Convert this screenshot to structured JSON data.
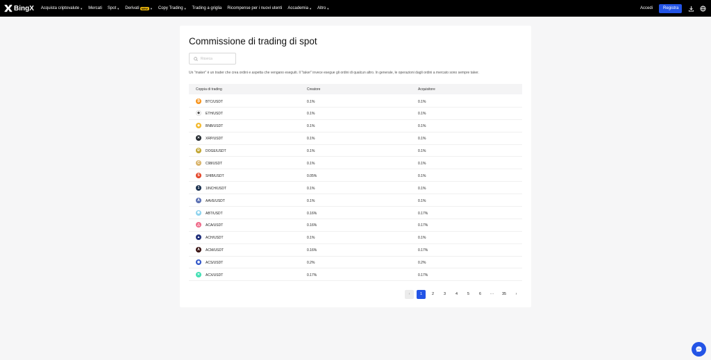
{
  "brand": {
    "name": "BingX"
  },
  "nav": {
    "items": [
      {
        "label": "Acquista criptovalute",
        "dropdown": true
      },
      {
        "label": "Mercati",
        "dropdown": false
      },
      {
        "label": "Spot",
        "dropdown": true
      },
      {
        "label": "Derivati",
        "dropdown": true,
        "badge": "NEW"
      },
      {
        "label": "Copy Trading",
        "dropdown": true
      },
      {
        "label": "Trading a griglia",
        "dropdown": false
      },
      {
        "label": "Ricompense per i nuovi utenti",
        "dropdown": false
      },
      {
        "label": "Accademia",
        "dropdown": true
      },
      {
        "label": "Altro",
        "dropdown": true
      }
    ],
    "login_label": "Accedi",
    "register_label": "Registra",
    "icons": [
      "download-icon",
      "globe-icon"
    ]
  },
  "page": {
    "title": "Commissione di trading di spot",
    "search_placeholder": "Ricerca",
    "description": "Un \"maker\" è un trader che crea ordini e aspetta che vengano eseguiti. Il \"taker\" invece esegue gli ordini di qualcun altro. In generale, le operazioni dagli ordini a mercato sono sempre taker."
  },
  "table": {
    "headers": {
      "pair": "Coppia di trading",
      "maker": "Creatore",
      "taker": "Acquisitore"
    },
    "rows": [
      {
        "pair": "BTC/USDT",
        "maker": "0.1%",
        "taker": "0.1%",
        "icon_color": "#f7931a",
        "glyph": "₿"
      },
      {
        "pair": "ETH/USDT",
        "maker": "0.1%",
        "taker": "0.1%",
        "icon_color": "#ffffff",
        "glyph": "◆"
      },
      {
        "pair": "BNB/USDT",
        "maker": "0.1%",
        "taker": "0.1%",
        "icon_color": "#f3ba2f",
        "glyph": "◈"
      },
      {
        "pair": "XRP/USDT",
        "maker": "0.1%",
        "taker": "0.1%",
        "icon_color": "#23292f",
        "glyph": "✕"
      },
      {
        "pair": "DOGE/USDT",
        "maker": "0.1%",
        "taker": "0.1%",
        "icon_color": "#c2a633",
        "glyph": "Ð"
      },
      {
        "pair": "C98/USDT",
        "maker": "0.1%",
        "taker": "0.1%",
        "icon_color": "#d9b36a",
        "glyph": "C"
      },
      {
        "pair": "SHIB/USDT",
        "maker": "0.05%",
        "taker": "0.1%",
        "icon_color": "#e4472a",
        "glyph": "S"
      },
      {
        "pair": "1INCH/USDT",
        "maker": "0.1%",
        "taker": "0.1%",
        "icon_color": "#1b314f",
        "glyph": "1"
      },
      {
        "pair": "AAVE/USDT",
        "maker": "0.1%",
        "taker": "0.1%",
        "icon_color": "#5a6fb2",
        "glyph": "A"
      },
      {
        "pair": "ABT/USDT",
        "maker": "0.16%",
        "taker": "0.17%",
        "icon_color": "#8ed3ee",
        "glyph": "✺"
      },
      {
        "pair": "ACA/USDT",
        "maker": "0.16%",
        "taker": "0.17%",
        "icon_color": "#ef6b8a",
        "glyph": "△"
      },
      {
        "pair": "ACH/USDT",
        "maker": "0.1%",
        "taker": "0.1%",
        "icon_color": "#1f2e7a",
        "glyph": "▲"
      },
      {
        "pair": "ACM/USDT",
        "maker": "0.16%",
        "taker": "0.17%",
        "icon_color": "#3a1414",
        "glyph": "A"
      },
      {
        "pair": "ACS/USDT",
        "maker": "0.2%",
        "taker": "0.2%",
        "icon_color": "#2f55c8",
        "glyph": "◉"
      },
      {
        "pair": "ACX/USDT",
        "maker": "0.17%",
        "taker": "0.17%",
        "icon_color": "#43e0b4",
        "glyph": "✕"
      }
    ]
  },
  "pagination": {
    "prev_label": "‹",
    "pages": [
      "1",
      "2",
      "3",
      "4",
      "5",
      "6",
      "···",
      "35"
    ],
    "current": "1",
    "next_label": "›"
  },
  "colors": {
    "brand_blue": "#2354e6",
    "header_bg": "#000000",
    "page_bg": "#f6f6f7"
  }
}
